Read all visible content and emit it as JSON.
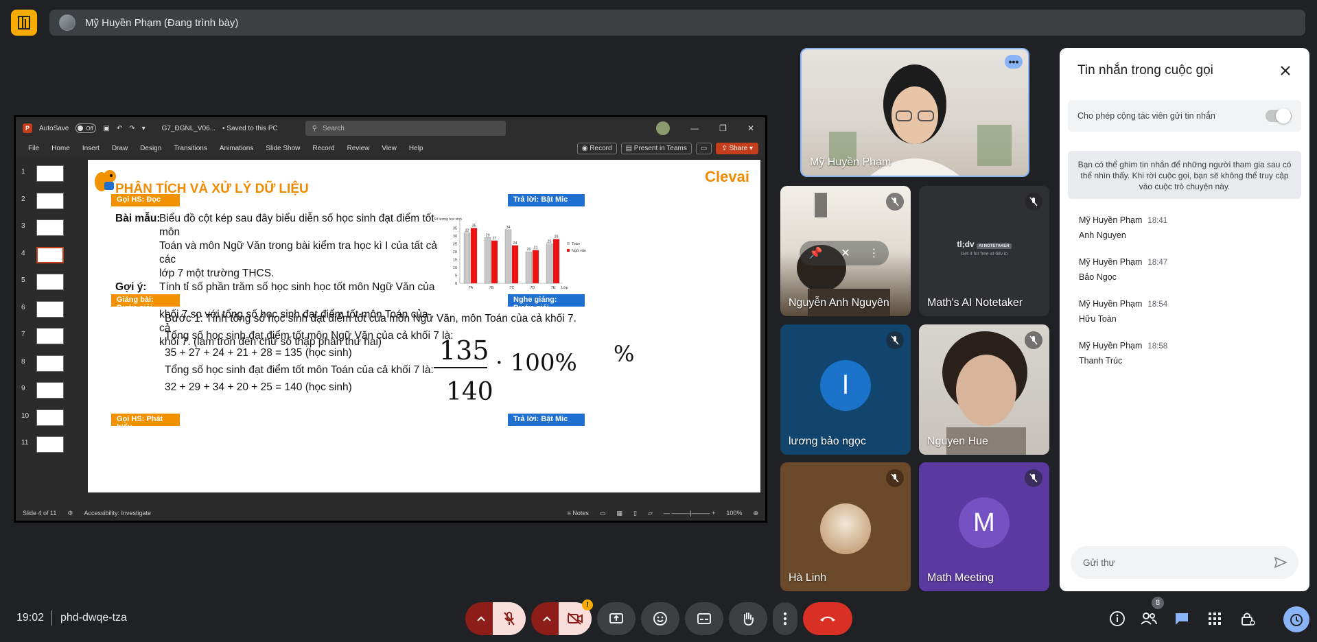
{
  "presenter": {
    "label": "Mỹ Huyền Phạm (Đang trình bày)"
  },
  "ppt": {
    "autosave": "AutoSave",
    "autosave_state": "Off",
    "file_name": "G7_ĐGNL_V06...",
    "saved": "• Saved to this PC",
    "search": "Search",
    "tabs": [
      "File",
      "Home",
      "Insert",
      "Draw",
      "Design",
      "Transitions",
      "Animations",
      "Slide Show",
      "Record",
      "Review",
      "View",
      "Help"
    ],
    "record_btn": "Record",
    "present_btn": "Present in Teams",
    "share_btn": "Share",
    "status_slide": "Slide 4 of 11",
    "status_access": "Accessibility: Investigate",
    "status_notes": "Notes",
    "status_zoom": "100%",
    "thumb_nums": [
      "1",
      "2",
      "3",
      "4",
      "5",
      "6",
      "7",
      "8",
      "9",
      "10",
      "11"
    ]
  },
  "slide": {
    "title": "PHÂN TÍCH VÀ XỬ LÝ DỮ LIỆU",
    "brand": "Clevai",
    "tag_read": "Gọi HS: Đọc",
    "tag_answer1": "Trả lời: Bật Mic",
    "sample_label": "Bài mẫu:",
    "sample_lines": [
      "Biểu đồ cột kép sau đây biểu diễn số học sinh đạt điểm tốt môn",
      "Toán và môn Ngữ Văn trong bài kiểm tra học kì I của tất cả các",
      "lớp 7 một trường THCS.",
      "Tính tỉ số phần trăm số học sinh học tốt môn Ngữ Văn của cả",
      "khối 7 so với tổng số học sinh đạt điểm tốt môn Toán của cả",
      "khối 7. (làm tròn đến chữ số thập phân thứ hai)"
    ],
    "hint_label": "Gợi ý:",
    "tag_lecture": "Giảng bài: Bước giải",
    "tag_listen": "Nghe giảng: Bước giải",
    "steps": [
      "Bước 1: Tính tổng số học sinh đạt điểm tốt của môn Ngữ Văn, môn Toán của cả khối 7.",
      "Tổng số học sinh đạt điểm tốt môn Ngữ Văn của cả khối 7 là:",
      "35 + 27 + 24 + 21 + 28 = 135 (học sinh)",
      "Tổng số học sinh đạt điểm tốt môn Toán của cả khối 7 là:",
      "32 + 29 + 34 + 20 + 25 = 140 (học sinh)"
    ],
    "hand_num": "135",
    "hand_den": "140",
    "hand_mul": "· 100%",
    "hand_pct": "%",
    "tag_speak": "Gọi HS: Phát biểu",
    "tag_answer2": "Trả lời: Bật Mic"
  },
  "chart_data": {
    "type": "bar",
    "ylabel": "Số lượng học sinh",
    "xlabel": "Lớp",
    "categories": [
      "7A",
      "7B",
      "7C",
      "7D",
      "7E"
    ],
    "ylim": [
      0,
      40
    ],
    "yticks": [
      0,
      5,
      10,
      15,
      20,
      25,
      30,
      35
    ],
    "series": [
      {
        "name": "Toán",
        "values": [
          32,
          29,
          34,
          20,
          25
        ],
        "color": "#c8c8c8"
      },
      {
        "name": "Ngữ văn",
        "values": [
          35,
          27,
          24,
          21,
          28
        ],
        "color": "#ee1111"
      }
    ],
    "legend": "right"
  },
  "participants": [
    {
      "name": "Mỹ Huyền Phạm"
    },
    {
      "name": "Nguyễn Anh Nguyên"
    },
    {
      "name": "Math's AI Notetaker",
      "logo": "tl;dv",
      "logo_sub": "AI NOTETAKER",
      "logo_tag": "Get it for free at tldv.io"
    },
    {
      "name": "lương bảo ngọc",
      "initial": "l"
    },
    {
      "name": "Nguyen Hue"
    },
    {
      "name": "Hà Linh"
    },
    {
      "name": "Math Meeting",
      "initial": "M"
    }
  ],
  "chat": {
    "title": "Tin nhắn trong cuộc gọi",
    "allow": "Cho phép cộng tác viên gửi tin nhắn",
    "note": "Bạn có thể ghim tin nhắn để những người tham gia sau có thể nhìn thấy. Khi rời cuộc gọi, bạn sẽ không thể truy cập vào cuộc trò chuyện này.",
    "messages": [
      {
        "who": "Mỹ Huyền Phạm",
        "time": "18:41",
        "text": "Anh Nguyen"
      },
      {
        "who": "Mỹ Huyền Phạm",
        "time": "18:47",
        "text": "Bảo Ngọc"
      },
      {
        "who": "Mỹ Huyền Phạm",
        "time": "18:54",
        "text": "Hữu Toàn"
      },
      {
        "who": "Mỹ Huyền Phạm",
        "time": "18:58",
        "text": "Thanh Trúc"
      }
    ],
    "placeholder": "Gửi thư"
  },
  "bottom": {
    "time": "19:02",
    "code": "phd-dwqe-tza",
    "people_count": "8",
    "camera_warning": "!"
  }
}
